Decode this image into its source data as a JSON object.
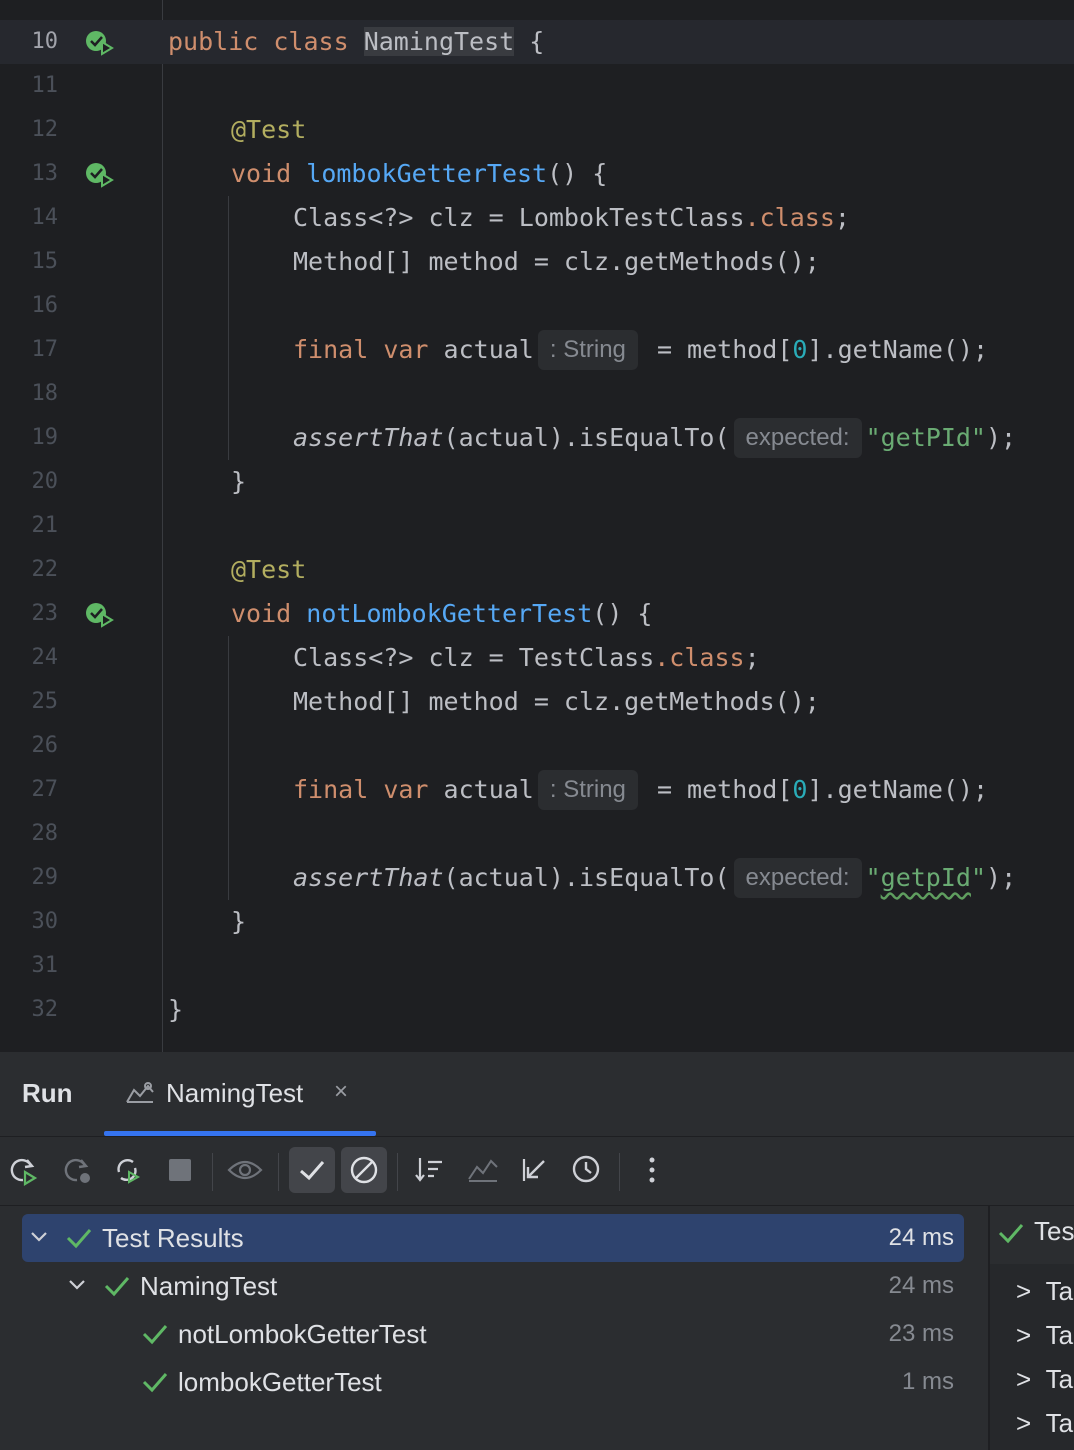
{
  "editor": {
    "lines": [
      {
        "n": "10",
        "current": true
      },
      {
        "n": "11"
      },
      {
        "n": "12"
      },
      {
        "n": "13"
      },
      {
        "n": "14"
      },
      {
        "n": "15"
      },
      {
        "n": "16"
      },
      {
        "n": "17"
      },
      {
        "n": "18"
      },
      {
        "n": "19"
      },
      {
        "n": "20"
      },
      {
        "n": "21"
      },
      {
        "n": "22"
      },
      {
        "n": "23"
      },
      {
        "n": "24"
      },
      {
        "n": "25"
      },
      {
        "n": "26"
      },
      {
        "n": "27"
      },
      {
        "n": "28"
      },
      {
        "n": "29"
      },
      {
        "n": "30"
      },
      {
        "n": "31"
      },
      {
        "n": "32"
      }
    ],
    "class_decl": {
      "kw_public": "public",
      "kw_class": "class",
      "name": "NamingTest",
      "brace": "{"
    },
    "annotation": "@Test",
    "kw_void": "void",
    "method1": "lombokGetterTest",
    "method2": "notLombokGetterTest",
    "parens_brace": "() {",
    "decl_class_prefix": "Class<?> clz = ",
    "decl_class_suffix": ".class",
    "semicolon": ";",
    "cls1": "LombokTestClass",
    "cls2": "TestClass",
    "methods_line": "Method[] method = clz.getMethods();",
    "kw_final": "final",
    "kw_var": "var",
    "actual": "actual",
    "type_hint": ": String",
    "assign_pre": "= method[",
    "index": "0",
    "assign_post": "].getName();",
    "assert_fn": "assertThat",
    "assert_mid": "(actual).isEqualTo(",
    "param_hint": "expected:",
    "expected1": "\"getPId\"",
    "expected2_open": "\"",
    "expected2_core": "getpId",
    "expected2_close": "\"",
    "assert_end": ");",
    "close_brace": "}"
  },
  "run_panel": {
    "title": "Run",
    "tab_label": "NamingTest",
    "tab_close": "×",
    "tree": {
      "root": {
        "label": "Test Results",
        "time": "24 ms"
      },
      "suite": {
        "label": "NamingTest",
        "time": "24 ms"
      },
      "tests": [
        {
          "label": "notLombokGetterTest",
          "time": "23 ms"
        },
        {
          "label": "lombokGetterTest",
          "time": "1 ms"
        }
      ]
    },
    "right_pane": {
      "header": "Tes",
      "items": [
        "Ta",
        "Ta",
        "Ta",
        "Ta"
      ],
      "chevron": ">"
    }
  },
  "colors": {
    "accent": "#3574f0",
    "pass": "#5fb865",
    "selection": "#2e436e"
  }
}
